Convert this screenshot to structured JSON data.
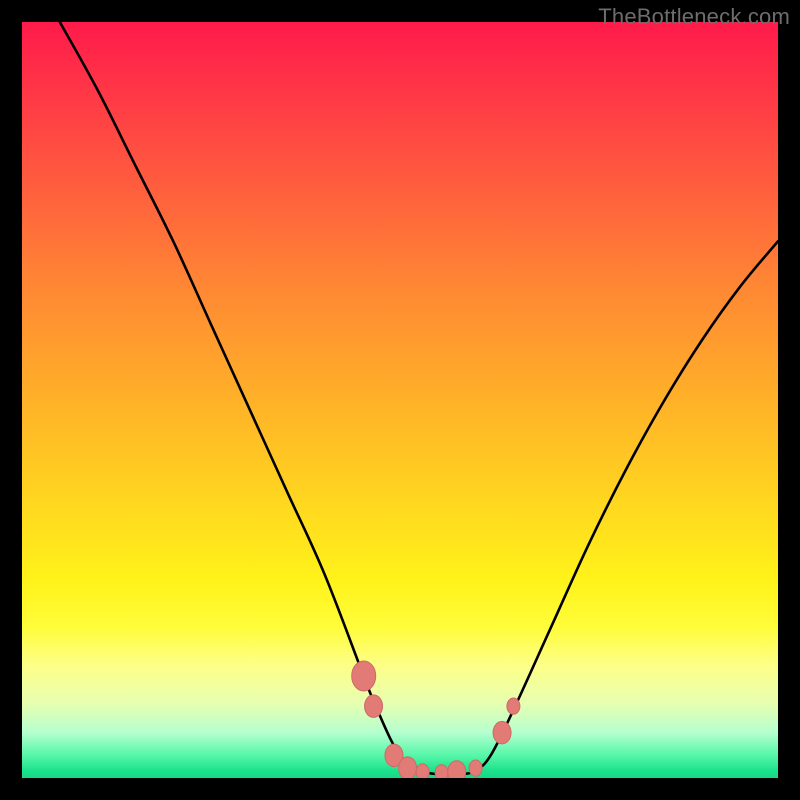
{
  "watermark": "TheBottleneck.com",
  "colors": {
    "frame": "#000000",
    "gradient_top": "#ff1a4a",
    "gradient_bottom": "#17d884",
    "curve_stroke": "#000000",
    "marker_fill": "#e27a76",
    "marker_stroke": "#cf6a66"
  },
  "chart_data": {
    "type": "line",
    "title": "",
    "xlabel": "",
    "ylabel": "",
    "xlim": [
      0,
      100
    ],
    "ylim": [
      0,
      100
    ],
    "series": [
      {
        "name": "curve",
        "x": [
          5,
          10,
          15,
          20,
          25,
          30,
          35,
          40,
          45,
          47,
          50,
          53,
          55,
          58,
          60,
          62,
          65,
          70,
          75,
          80,
          85,
          90,
          95,
          100
        ],
        "y": [
          100,
          91,
          81,
          71,
          60,
          49,
          38,
          27,
          14,
          9,
          3,
          1,
          0.5,
          0.5,
          1,
          3,
          9,
          20,
          31,
          41,
          50,
          58,
          65,
          71
        ]
      }
    ],
    "markers": [
      {
        "x": 45.2,
        "y": 13.5,
        "size": "large"
      },
      {
        "x": 46.5,
        "y": 9.5,
        "size": "medium"
      },
      {
        "x": 49.2,
        "y": 3.0,
        "size": "medium"
      },
      {
        "x": 51.0,
        "y": 1.3,
        "size": "medium"
      },
      {
        "x": 53.0,
        "y": 0.8,
        "size": "small"
      },
      {
        "x": 55.5,
        "y": 0.7,
        "size": "small"
      },
      {
        "x": 57.5,
        "y": 0.8,
        "size": "medium"
      },
      {
        "x": 60.0,
        "y": 1.3,
        "size": "small"
      },
      {
        "x": 63.5,
        "y": 6.0,
        "size": "medium"
      },
      {
        "x": 65.0,
        "y": 9.5,
        "size": "small"
      }
    ]
  }
}
